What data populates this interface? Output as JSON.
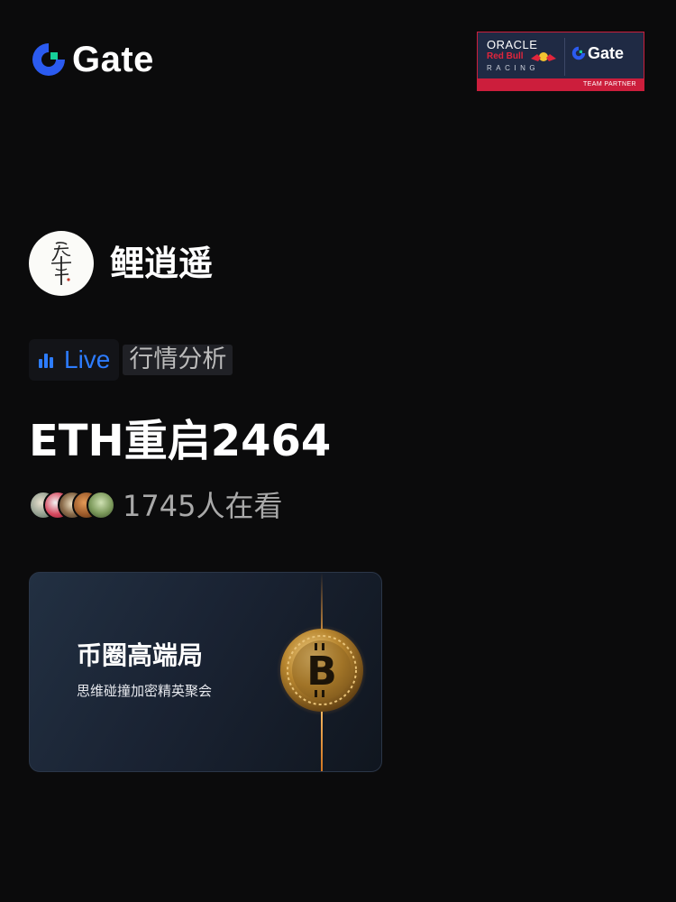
{
  "header": {
    "brand_name": "Gate",
    "partner": {
      "oracle": "ORACLE",
      "red_bull": "Red Bull",
      "racing": "RACING",
      "gate": "Gate",
      "band_text": "TEAM PARTNER"
    }
  },
  "host": {
    "name": "鲤逍遥",
    "avatar_icon": "calligraphy-avatar"
  },
  "tags": {
    "live_icon": "bar-chart-icon",
    "live_label": "Live",
    "category": "行情分析"
  },
  "stream": {
    "title": "ETH重启2464"
  },
  "viewers": {
    "count_text": "1745人在看",
    "avatars": [
      "viewer-1",
      "viewer-2",
      "viewer-3",
      "viewer-4",
      "viewer-5"
    ]
  },
  "banner": {
    "title": "币圈高端局",
    "subtitle": "思维碰撞加密精英聚会",
    "coin_icon": "bitcoin-coin-icon"
  },
  "colors": {
    "background": "#0b0b0c",
    "brand_blue": "#2b5bf0",
    "brand_green": "#16d09a",
    "live_blue": "#2d7cff",
    "partner_navy": "#1f2a44",
    "partner_red": "#cc1e3c",
    "text_primary": "#ffffff",
    "text_secondary": "#a9a9a9"
  }
}
